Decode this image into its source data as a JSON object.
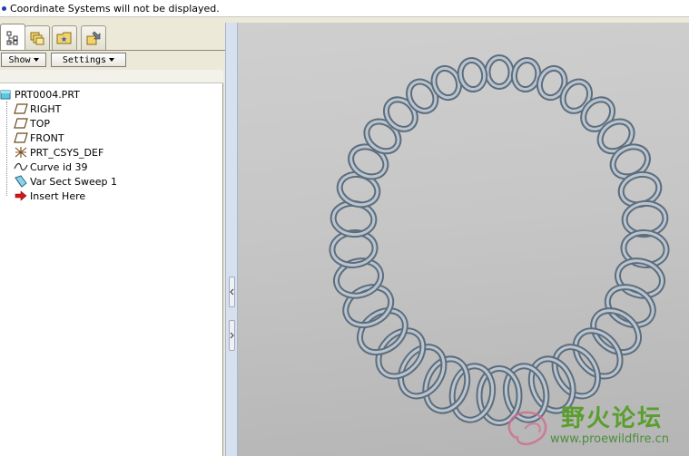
{
  "message_bar": {
    "text": "Coordinate Systems will not be displayed."
  },
  "navigator": {
    "tabs": [
      {
        "icon": "model-tree-icon",
        "active": true
      },
      {
        "icon": "folder-browser-icon",
        "active": false
      },
      {
        "icon": "favorites-icon",
        "active": false
      },
      {
        "icon": "connections-icon",
        "active": false
      }
    ],
    "toolbar": {
      "show_label": "Show",
      "settings_label": "Settings"
    },
    "tree": {
      "root": "PRT0004.PRT",
      "items": [
        {
          "label": "RIGHT",
          "icon": "datum-plane-icon"
        },
        {
          "label": "TOP",
          "icon": "datum-plane-icon"
        },
        {
          "label": "FRONT",
          "icon": "datum-plane-icon"
        },
        {
          "label": "PRT_CSYS_DEF",
          "icon": "coordinate-system-icon"
        },
        {
          "label": "Curve id 39",
          "icon": "curve-icon"
        },
        {
          "label": "Var Sect Sweep 1",
          "icon": "sweep-icon"
        },
        {
          "label": "Insert Here",
          "icon": "insert-arrow-icon"
        }
      ]
    }
  },
  "watermark": {
    "title": "野火论坛",
    "url": "www.proewildfire.cn"
  },
  "colors": {
    "viewport_bg": "#c6c6c6",
    "spring": "#8a9aaa",
    "watermark": "#5a9e2e"
  }
}
